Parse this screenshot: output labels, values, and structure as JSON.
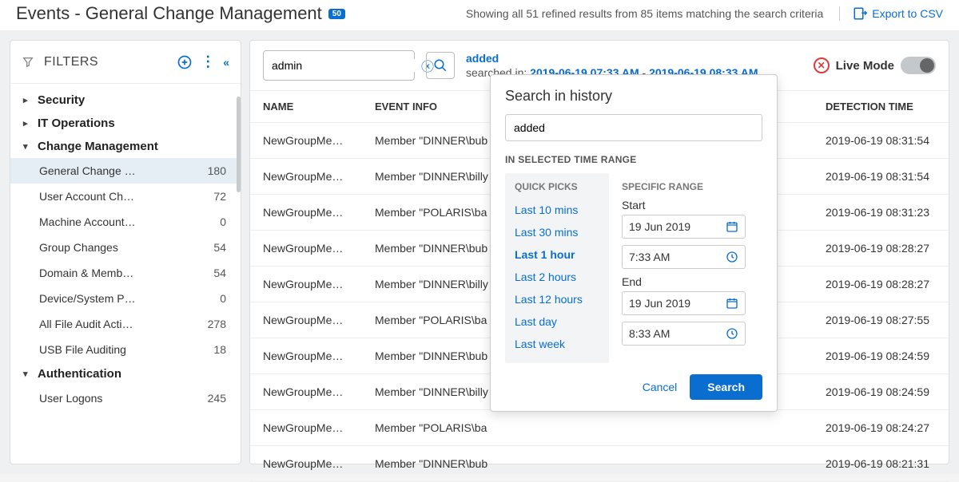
{
  "page": {
    "title": "Events - General Change Management",
    "badge": "50"
  },
  "results": {
    "text": "Showing all 51 refined results from 85 items matching the search criteria",
    "export_label": "Export to CSV"
  },
  "sidebar": {
    "title": "FILTERS",
    "sections": [
      {
        "label": "Security",
        "expanded": false
      },
      {
        "label": "IT Operations",
        "expanded": false
      },
      {
        "label": "Change Management",
        "expanded": true,
        "items": [
          {
            "label": "General Change …",
            "count": "180",
            "selected": true
          },
          {
            "label": "User Account Ch…",
            "count": "72"
          },
          {
            "label": "Machine Account…",
            "count": "0"
          },
          {
            "label": "Group Changes",
            "count": "54"
          },
          {
            "label": "Domain & Memb…",
            "count": "54"
          },
          {
            "label": "Device/System P…",
            "count": "0"
          },
          {
            "label": "All File Audit Acti…",
            "count": "278"
          },
          {
            "label": "USB File Auditing",
            "count": "18"
          }
        ]
      },
      {
        "label": "Authentication",
        "expanded": true,
        "items": [
          {
            "label": "User Logons",
            "count": "245"
          }
        ]
      }
    ]
  },
  "search": {
    "value": "admin",
    "term_label": "added",
    "searched_in_prefix": "searched in: ",
    "range_start": "2019-06-19 07:33 AM",
    "range_sep": " - ",
    "range_end": "2019-06-19 08:33 AM"
  },
  "live": {
    "label": "Live Mode"
  },
  "table": {
    "headers": {
      "name": "NAME",
      "info": "EVENT INFO",
      "time": "DETECTION TIME"
    },
    "rows": [
      {
        "name": "NewGroupMem…",
        "info": "Member \"DINNER\\bub",
        "time": "2019-06-19 08:31:54"
      },
      {
        "name": "NewGroupMem…",
        "info": "Member \"DINNER\\billy",
        "time": "2019-06-19 08:31:54"
      },
      {
        "name": "NewGroupMem…",
        "info": "Member \"POLARIS\\ba",
        "time": "2019-06-19 08:31:23"
      },
      {
        "name": "NewGroupMem…",
        "info": "Member \"DINNER\\bub",
        "time": "2019-06-19 08:28:27"
      },
      {
        "name": "NewGroupMem…",
        "info": "Member \"DINNER\\billy",
        "time": "2019-06-19 08:28:27"
      },
      {
        "name": "NewGroupMem…",
        "info": "Member \"POLARIS\\ba",
        "time": "2019-06-19 08:27:55"
      },
      {
        "name": "NewGroupMem…",
        "info": "Member \"DINNER\\bub",
        "time": "2019-06-19 08:24:59"
      },
      {
        "name": "NewGroupMem…",
        "info": "Member \"DINNER\\billy",
        "time": "2019-06-19 08:24:59"
      },
      {
        "name": "NewGroupMem…",
        "info": "Member \"POLARIS\\ba",
        "time": "2019-06-19 08:24:27"
      },
      {
        "name": "NewGroupMem…",
        "info": "Member \"DINNER\\bub",
        "time": "2019-06-19 08:21:31"
      }
    ]
  },
  "popover": {
    "title": "Search in history",
    "input_value": "added",
    "section_label": "IN SELECTED TIME RANGE",
    "quick_header": "QUICK PICKS",
    "quick": [
      {
        "label": "Last 10 mins"
      },
      {
        "label": "Last 30 mins"
      },
      {
        "label": "Last 1 hour",
        "active": true
      },
      {
        "label": "Last 2 hours"
      },
      {
        "label": "Last 12 hours"
      },
      {
        "label": "Last day"
      },
      {
        "label": "Last week"
      }
    ],
    "specific_header": "SPECIFIC RANGE",
    "start_label": "Start",
    "start_date": "19 Jun 2019",
    "start_time": "7:33 AM",
    "end_label": "End",
    "end_date": "19 Jun 2019",
    "end_time": "8:33 AM",
    "cancel": "Cancel",
    "search": "Search"
  }
}
